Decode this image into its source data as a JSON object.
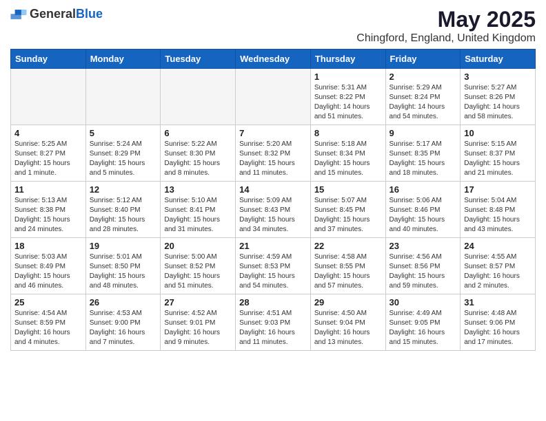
{
  "logo": {
    "general": "General",
    "blue": "Blue"
  },
  "title": "May 2025",
  "subtitle": "Chingford, England, United Kingdom",
  "days": [
    "Sunday",
    "Monday",
    "Tuesday",
    "Wednesday",
    "Thursday",
    "Friday",
    "Saturday"
  ],
  "weeks": [
    [
      {
        "day": "",
        "content": ""
      },
      {
        "day": "",
        "content": ""
      },
      {
        "day": "",
        "content": ""
      },
      {
        "day": "",
        "content": ""
      },
      {
        "day": "1",
        "content": "Sunrise: 5:31 AM\nSunset: 8:22 PM\nDaylight: 14 hours\nand 51 minutes."
      },
      {
        "day": "2",
        "content": "Sunrise: 5:29 AM\nSunset: 8:24 PM\nDaylight: 14 hours\nand 54 minutes."
      },
      {
        "day": "3",
        "content": "Sunrise: 5:27 AM\nSunset: 8:26 PM\nDaylight: 14 hours\nand 58 minutes."
      }
    ],
    [
      {
        "day": "4",
        "content": "Sunrise: 5:25 AM\nSunset: 8:27 PM\nDaylight: 15 hours\nand 1 minute."
      },
      {
        "day": "5",
        "content": "Sunrise: 5:24 AM\nSunset: 8:29 PM\nDaylight: 15 hours\nand 5 minutes."
      },
      {
        "day": "6",
        "content": "Sunrise: 5:22 AM\nSunset: 8:30 PM\nDaylight: 15 hours\nand 8 minutes."
      },
      {
        "day": "7",
        "content": "Sunrise: 5:20 AM\nSunset: 8:32 PM\nDaylight: 15 hours\nand 11 minutes."
      },
      {
        "day": "8",
        "content": "Sunrise: 5:18 AM\nSunset: 8:34 PM\nDaylight: 15 hours\nand 15 minutes."
      },
      {
        "day": "9",
        "content": "Sunrise: 5:17 AM\nSunset: 8:35 PM\nDaylight: 15 hours\nand 18 minutes."
      },
      {
        "day": "10",
        "content": "Sunrise: 5:15 AM\nSunset: 8:37 PM\nDaylight: 15 hours\nand 21 minutes."
      }
    ],
    [
      {
        "day": "11",
        "content": "Sunrise: 5:13 AM\nSunset: 8:38 PM\nDaylight: 15 hours\nand 24 minutes."
      },
      {
        "day": "12",
        "content": "Sunrise: 5:12 AM\nSunset: 8:40 PM\nDaylight: 15 hours\nand 28 minutes."
      },
      {
        "day": "13",
        "content": "Sunrise: 5:10 AM\nSunset: 8:41 PM\nDaylight: 15 hours\nand 31 minutes."
      },
      {
        "day": "14",
        "content": "Sunrise: 5:09 AM\nSunset: 8:43 PM\nDaylight: 15 hours\nand 34 minutes."
      },
      {
        "day": "15",
        "content": "Sunrise: 5:07 AM\nSunset: 8:45 PM\nDaylight: 15 hours\nand 37 minutes."
      },
      {
        "day": "16",
        "content": "Sunrise: 5:06 AM\nSunset: 8:46 PM\nDaylight: 15 hours\nand 40 minutes."
      },
      {
        "day": "17",
        "content": "Sunrise: 5:04 AM\nSunset: 8:48 PM\nDaylight: 15 hours\nand 43 minutes."
      }
    ],
    [
      {
        "day": "18",
        "content": "Sunrise: 5:03 AM\nSunset: 8:49 PM\nDaylight: 15 hours\nand 46 minutes."
      },
      {
        "day": "19",
        "content": "Sunrise: 5:01 AM\nSunset: 8:50 PM\nDaylight: 15 hours\nand 48 minutes."
      },
      {
        "day": "20",
        "content": "Sunrise: 5:00 AM\nSunset: 8:52 PM\nDaylight: 15 hours\nand 51 minutes."
      },
      {
        "day": "21",
        "content": "Sunrise: 4:59 AM\nSunset: 8:53 PM\nDaylight: 15 hours\nand 54 minutes."
      },
      {
        "day": "22",
        "content": "Sunrise: 4:58 AM\nSunset: 8:55 PM\nDaylight: 15 hours\nand 57 minutes."
      },
      {
        "day": "23",
        "content": "Sunrise: 4:56 AM\nSunset: 8:56 PM\nDaylight: 15 hours\nand 59 minutes."
      },
      {
        "day": "24",
        "content": "Sunrise: 4:55 AM\nSunset: 8:57 PM\nDaylight: 16 hours\nand 2 minutes."
      }
    ],
    [
      {
        "day": "25",
        "content": "Sunrise: 4:54 AM\nSunset: 8:59 PM\nDaylight: 16 hours\nand 4 minutes."
      },
      {
        "day": "26",
        "content": "Sunrise: 4:53 AM\nSunset: 9:00 PM\nDaylight: 16 hours\nand 7 minutes."
      },
      {
        "day": "27",
        "content": "Sunrise: 4:52 AM\nSunset: 9:01 PM\nDaylight: 16 hours\nand 9 minutes."
      },
      {
        "day": "28",
        "content": "Sunrise: 4:51 AM\nSunset: 9:03 PM\nDaylight: 16 hours\nand 11 minutes."
      },
      {
        "day": "29",
        "content": "Sunrise: 4:50 AM\nSunset: 9:04 PM\nDaylight: 16 hours\nand 13 minutes."
      },
      {
        "day": "30",
        "content": "Sunrise: 4:49 AM\nSunset: 9:05 PM\nDaylight: 16 hours\nand 15 minutes."
      },
      {
        "day": "31",
        "content": "Sunrise: 4:48 AM\nSunset: 9:06 PM\nDaylight: 16 hours\nand 17 minutes."
      }
    ]
  ]
}
